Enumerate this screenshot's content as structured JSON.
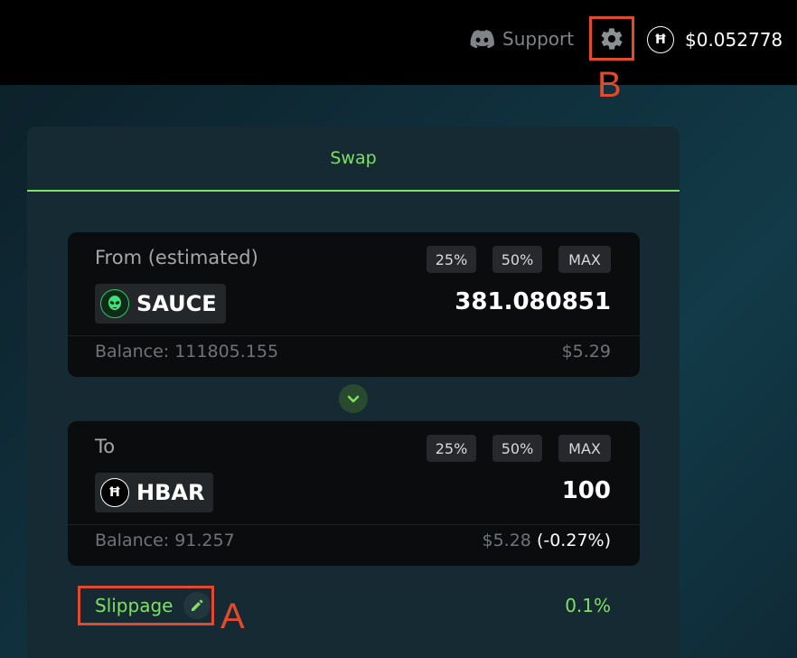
{
  "header": {
    "support_label": "Support",
    "hbar_symbol": "Ħ",
    "hbar_price": "$0.052778"
  },
  "annotations": {
    "a": "A",
    "b": "B",
    "color": "#e14a2d"
  },
  "tabs": {
    "swap_label": "Swap"
  },
  "from_card": {
    "label": "From (estimated)",
    "pct_25": "25%",
    "pct_50": "50%",
    "pct_max": "MAX",
    "token": "SAUCE",
    "token_icon": "alien-icon",
    "amount": "381.080851",
    "balance": "Balance: 111805.155",
    "usd_value": "$5.29"
  },
  "to_card": {
    "label": "To",
    "pct_25": "25%",
    "pct_50": "50%",
    "pct_max": "MAX",
    "token": "HBAR",
    "token_icon_symbol": "Ħ",
    "amount": "100",
    "balance": "Balance: 91.257",
    "usd_value": "$5.28",
    "usd_delta": "(-0.27%)"
  },
  "slippage": {
    "label": "Slippage",
    "value": "0.1%"
  },
  "colors": {
    "accent_green": "#7fe061",
    "background_dark": "#000000",
    "card_bg": "#0b0c0d",
    "panel_bg": "#162a33"
  }
}
